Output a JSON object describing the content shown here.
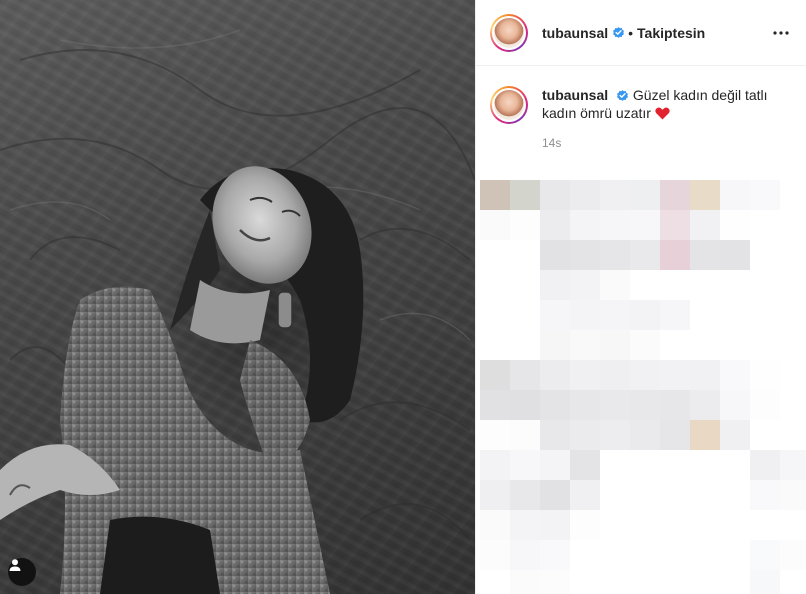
{
  "post": {
    "username": "tubaunsal",
    "verified": true,
    "follow_status": "Takiptesin",
    "separator": "•",
    "caption_text": "Güzel kadın değil tatlı kadın ömrü uzatır",
    "caption_emoji": "❤️",
    "timestamp": "14s"
  },
  "icons": {
    "verified": "verified-badge-icon",
    "more": "more-options-icon",
    "user_tag": "user-tag-icon",
    "heart": "red-heart-icon"
  },
  "colors": {
    "verified_blue": "#3897f0",
    "text_primary": "#262626",
    "text_secondary": "#8e8e8e",
    "heart_red": "#e0232e",
    "border": "#efefef"
  },
  "censored_area": {
    "pixel_colors": [
      [
        "#cfc2b6",
        "#d3d5cd",
        "#e8e8ea",
        "#ececef",
        "#f0f0f2",
        "#eeeff1",
        "#e6d6dc",
        "#e8dcc8",
        "#f7f7f9",
        "#f9f9fb",
        "#ffffff"
      ],
      [
        "#fafafa",
        "#fdfdfd",
        "#ececee",
        "#f4f4f6",
        "#f6f6f8",
        "#f7f7f9",
        "#eedfe4",
        "#f1f1f3",
        "#fefefe",
        "#ffffff",
        "#ffffff"
      ],
      [
        "#ffffff",
        "#ffffff",
        "#e2e2e4",
        "#e4e4e6",
        "#e6e6e8",
        "#e9e9eb",
        "#e7d0d7",
        "#e4e4e6",
        "#e3e3e5",
        "#ffffff",
        "#ffffff"
      ],
      [
        "#ffffff",
        "#ffffff",
        "#f1f1f3",
        "#f3f3f5",
        "#fafafa",
        "#ffffff",
        "#ffffff",
        "#ffffff",
        "#ffffff",
        "#ffffff",
        "#ffffff"
      ],
      [
        "#ffffff",
        "#ffffff",
        "#f6f6f8",
        "#f4f4f6",
        "#f5f5f7",
        "#f3f3f5",
        "#f6f6f8",
        "#ffffff",
        "#ffffff",
        "#ffffff",
        "#ffffff"
      ],
      [
        "#ffffff",
        "#ffffff",
        "#f6f6f6",
        "#f9f9fa",
        "#f7f7f8",
        "#fbfbfc",
        "#ffffff",
        "#ffffff",
        "#ffffff",
        "#ffffff",
        "#ffffff"
      ],
      [
        "#dededf",
        "#e6e6e8",
        "#ececee",
        "#f0f0f2",
        "#efeff1",
        "#f1f1f3",
        "#f2f2f4",
        "#f1f1f3",
        "#f9f9fb",
        "#fefefe",
        "#ffffff"
      ],
      [
        "#e1e1e3",
        "#e0e0e2",
        "#e4e4e6",
        "#e7e7e9",
        "#e9e9eb",
        "#e8e8ea",
        "#e7e7e9",
        "#ececee",
        "#f7f7f9",
        "#fdfdfd",
        "#ffffff"
      ],
      [
        "#fdfdfd",
        "#fcfcfc",
        "#e8e8ea",
        "#ebebed",
        "#ededef",
        "#eaeaec",
        "#e6e6e8",
        "#e9d8c4",
        "#f0f0f2",
        "#ffffff",
        "#ffffff"
      ],
      [
        "#f3f3f5",
        "#f7f7f9",
        "#f4f4f6",
        "#e4e4e6",
        "#ffffff",
        "#ffffff",
        "#ffffff",
        "#ffffff",
        "#ffffff",
        "#f0f0f2",
        "#f6f6f8"
      ],
      [
        "#efeff1",
        "#e8e8ea",
        "#e2e2e4",
        "#f0f0f2",
        "#ffffff",
        "#ffffff",
        "#ffffff",
        "#ffffff",
        "#ffffff",
        "#f9f9fb",
        "#fafafa"
      ],
      [
        "#fafafa",
        "#f4f4f6",
        "#f3f3f5",
        "#fdfdfd",
        "#ffffff",
        "#ffffff",
        "#ffffff",
        "#ffffff",
        "#ffffff",
        "#ffffff",
        "#ffffff"
      ],
      [
        "#fcfcfc",
        "#f7f7f9",
        "#f9f9fb",
        "#ffffff",
        "#ffffff",
        "#ffffff",
        "#ffffff",
        "#ffffff",
        "#ffffff",
        "#f8fafc",
        "#fcfcfd"
      ],
      [
        "#ffffff",
        "#fbfbfb",
        "#fcfcfc",
        "#ffffff",
        "#ffffff",
        "#ffffff",
        "#ffffff",
        "#ffffff",
        "#ffffff",
        "#f6f8fa",
        "#ffffff"
      ]
    ]
  }
}
